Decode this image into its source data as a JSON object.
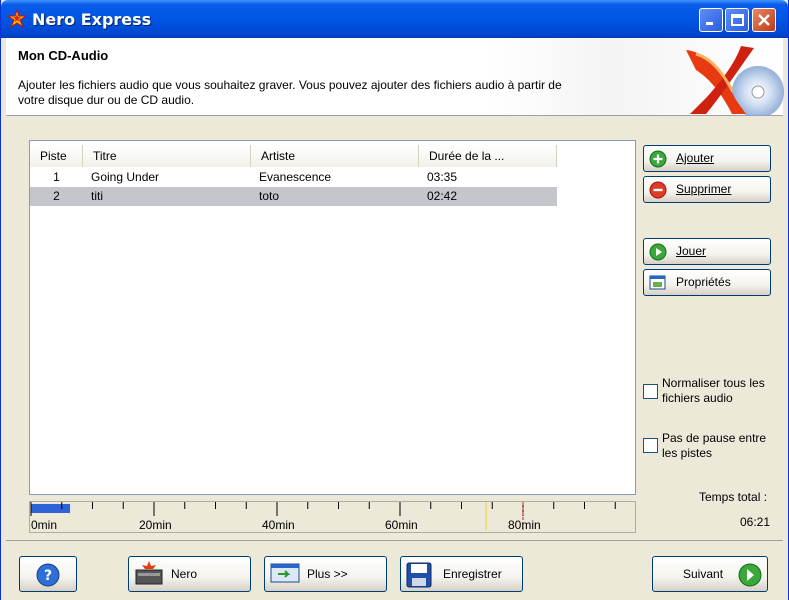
{
  "window": {
    "title": "Nero Express"
  },
  "header": {
    "title": "Mon CD-Audio",
    "description": "Ajouter les fichiers audio que vous souhaitez graver. Vous pouvez ajouter des fichiers audio à partir de votre disque dur ou de CD audio."
  },
  "table": {
    "columns": [
      "Piste",
      "Titre",
      "Artiste",
      "Durée de la ..."
    ],
    "rows": [
      {
        "piste": "1",
        "titre": "Going Under",
        "artiste": "Evanescence",
        "duree": "03:35"
      },
      {
        "piste": "2",
        "titre": "titi",
        "artiste": "toto",
        "duree": "02:42"
      }
    ]
  },
  "actions": {
    "ajouter": "Ajouter",
    "supprimer": "Supprimer",
    "jouer": "Jouer",
    "proprietes": "Propriétés"
  },
  "options": {
    "normaliser": "Normaliser tous les fichiers audio",
    "pas_de_pause": "Pas de pause entre les pistes",
    "normaliser_checked": false,
    "pas_de_pause_checked": false
  },
  "total": {
    "label": "Temps total :",
    "value": "06:21"
  },
  "ruler": {
    "labels": [
      "0min",
      "20min",
      "40min",
      "60min",
      "80min"
    ],
    "used_minutes": 6.35,
    "capacity_markers_min": [
      74,
      80
    ]
  },
  "bottom": {
    "nero": "Nero",
    "plus": "Plus >>",
    "enregistrer": "Enregistrer",
    "suivant": "Suivant"
  },
  "colors": {
    "titlebar": "#0055e5",
    "selected_row": "#c5c6cc",
    "usage_bar": "#2c64d8"
  }
}
